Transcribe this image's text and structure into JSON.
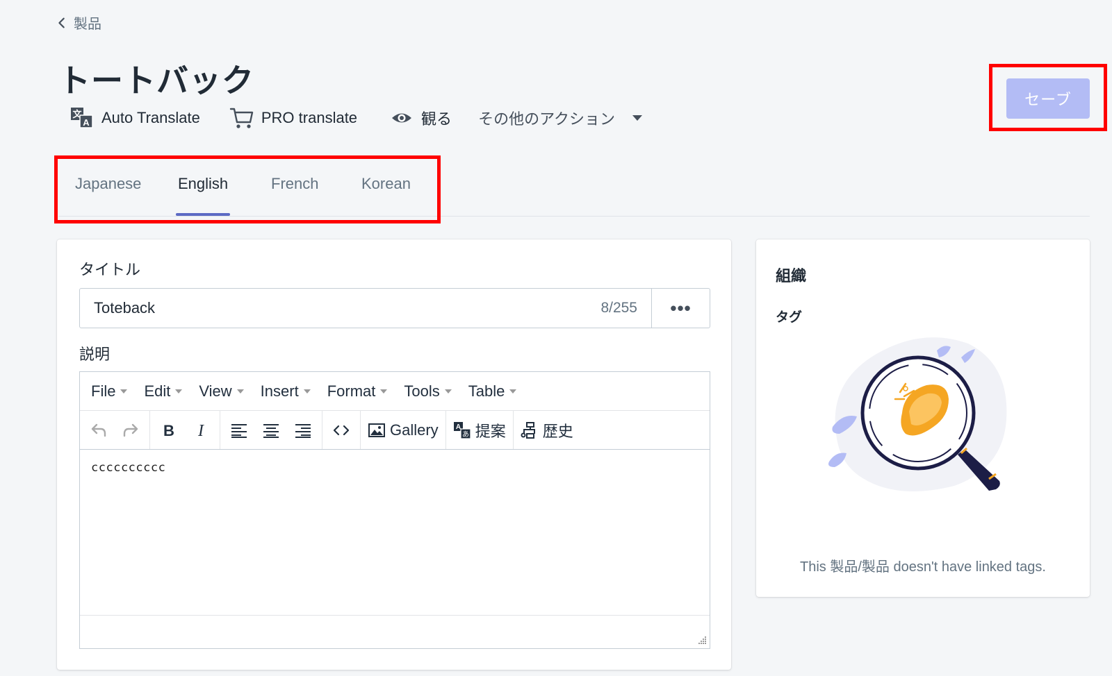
{
  "breadcrumb": {
    "label": "製品"
  },
  "page": {
    "title": "トートバック"
  },
  "actions": {
    "auto_translate": "Auto Translate",
    "pro_translate": "PRO translate",
    "view": "観る",
    "more": "その他のアクション"
  },
  "save": {
    "label": "セーブ",
    "color": "#b3bcf5"
  },
  "tabs": [
    {
      "label": "Japanese",
      "active": false
    },
    {
      "label": "English",
      "active": true
    },
    {
      "label": "French",
      "active": false
    },
    {
      "label": "Korean",
      "active": false
    }
  ],
  "form": {
    "title_label": "タイトル",
    "title_value": "Toteback",
    "title_counter": "8/255",
    "more_icon": "•••",
    "description_label": "説明"
  },
  "editor": {
    "menus": [
      "File",
      "Edit",
      "View",
      "Insert",
      "Format",
      "Tools",
      "Table"
    ],
    "gallery_label": "Gallery",
    "suggest_label": "提案",
    "history_label": "歴史",
    "content": "cccccccccc"
  },
  "sidebar": {
    "title": "組織",
    "tags_label": "タグ",
    "empty_text": "This 製品/製品 doesn't have linked tags."
  },
  "colors": {
    "accent": "#5c6ac4",
    "highlight": "#ff0000"
  }
}
